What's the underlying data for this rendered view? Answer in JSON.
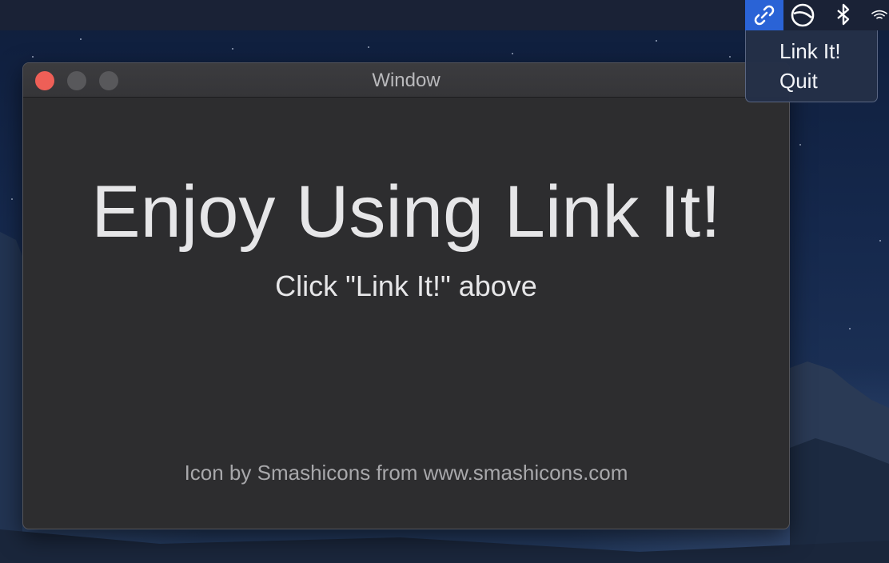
{
  "menubar": {
    "icons": [
      "link-icon",
      "circle-slash-icon",
      "bluetooth-icon",
      "wifi-icon"
    ],
    "active_color": "#2a63d6"
  },
  "dropdown": {
    "items": [
      {
        "label": "Link It!"
      },
      {
        "label": "Quit"
      }
    ]
  },
  "window": {
    "title": "Window",
    "headline": "Enjoy Using Link It!",
    "subheadline": "Click \"Link It!\" above",
    "credit": "Icon by Smashicons from www.smashicons.com"
  },
  "colors": {
    "close_button": "#ee5f57",
    "window_background": "#2d2d2f"
  }
}
